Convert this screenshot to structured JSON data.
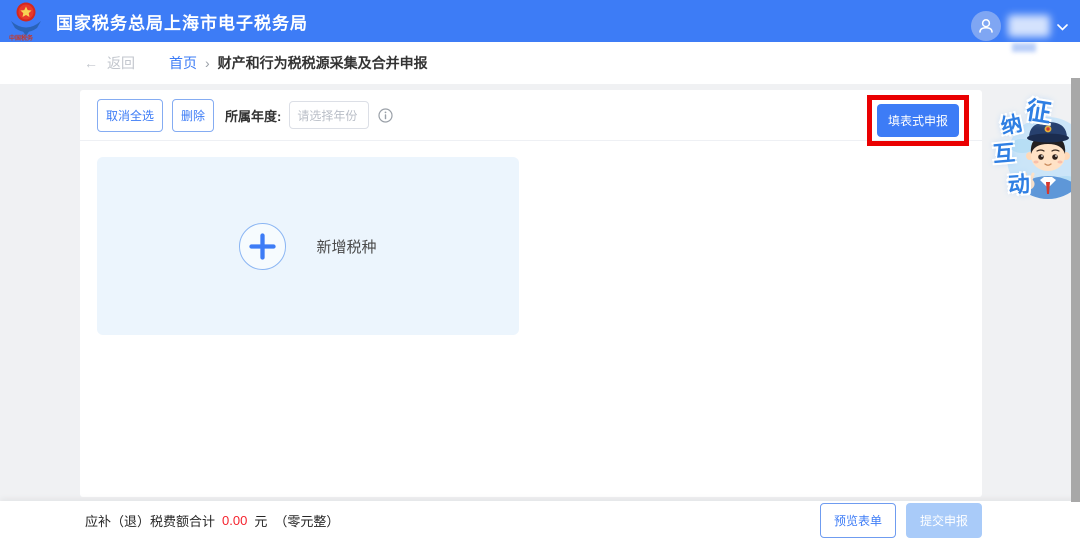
{
  "header": {
    "title": "国家税务总局上海市电子税务局",
    "logo_text": "中国税务"
  },
  "breadcrumb": {
    "back_arrow": "←",
    "back": "返回",
    "home": "首页",
    "separator": "›",
    "current": "财产和行为税税源采集及合并申报"
  },
  "toolbar": {
    "cancel_select_all": "取消全选",
    "delete": "删除",
    "year_label": "所属年度:",
    "year_placeholder": "请选择年份",
    "fill_form_declare": "填表式申报"
  },
  "content": {
    "add_tax_type": "新增税种"
  },
  "mascot": {
    "chars": [
      "征",
      "纳",
      "互",
      "动"
    ]
  },
  "footer": {
    "total_label": "应补（退）税费额合计",
    "amount": "0.00",
    "currency": "元",
    "amount_in_words": "（零元整）",
    "preview_form": "预览表单",
    "submit_declare": "提交申报"
  },
  "colors": {
    "header_bg": "#3d7cf6",
    "accent_blue": "#3d7cf6",
    "highlight_red": "#ea0001",
    "amount_red": "#f5222d",
    "empty_panel_bg": "#ecf5fd",
    "page_bg": "#f0f1f3",
    "disabled_submit_bg": "#a9cbf9"
  }
}
